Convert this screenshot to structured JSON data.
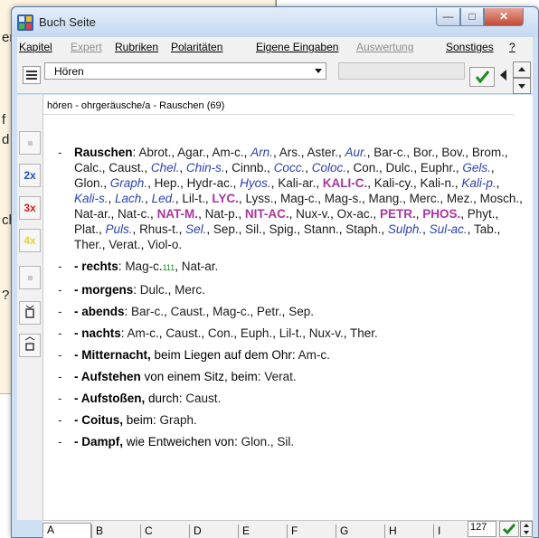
{
  "window": {
    "title": "Buch Seite"
  },
  "background": {
    "fragments": [
      "er",
      "f",
      "d",
      "ch",
      "?"
    ]
  },
  "menu": [
    {
      "label": "Kapitel",
      "enabled": true
    },
    {
      "label": "Expert",
      "enabled": false
    },
    {
      "label": "Rubriken",
      "enabled": true
    },
    {
      "label": "Polaritäten",
      "enabled": true
    },
    {
      "label": "Eigene Eingaben",
      "enabled": true
    },
    {
      "label": "Auswertung",
      "enabled": false
    },
    {
      "label": "Sonstiges",
      "enabled": true
    },
    {
      "label": "?",
      "enabled": true
    }
  ],
  "toolbar": {
    "chapter_value": "Hören"
  },
  "left_tools": {
    "btn_2x": "2x",
    "btn_3x": "3x",
    "btn_4x": "4x",
    "colors": {
      "2x": "#1f4fbf",
      "3x": "#d21f1f",
      "4x": "#e6d23a"
    }
  },
  "path": "hören - ohrgeräusche/a - Rauschen (69)",
  "rubrics": [
    {
      "title": "Rauschen",
      "tail": ":",
      "remedies": [
        {
          "t": "Abrot.",
          "g": 1
        },
        {
          "t": "Agar.",
          "g": 1
        },
        {
          "t": "Am-c.",
          "g": 1
        },
        {
          "t": "Arn.",
          "g": 2
        },
        {
          "t": "Ars.",
          "g": 1
        },
        {
          "t": "Aster.",
          "g": 1
        },
        {
          "t": "Aur.",
          "g": 2
        },
        {
          "t": "Bar-c.",
          "g": 1
        },
        {
          "t": "Bor.",
          "g": 1
        },
        {
          "t": "Bov.",
          "g": 1
        },
        {
          "t": "Brom.",
          "g": 1
        },
        {
          "t": "Calc.",
          "g": 1
        },
        {
          "t": "Caust.",
          "g": 1
        },
        {
          "t": "Chel.",
          "g": 2
        },
        {
          "t": "Chin-s.",
          "g": 2
        },
        {
          "t": "Cinnb.",
          "g": 1
        },
        {
          "t": "Cocc.",
          "g": 2
        },
        {
          "t": "Coloc.",
          "g": 2
        },
        {
          "t": "Con.",
          "g": 1
        },
        {
          "t": "Dulc.",
          "g": 1
        },
        {
          "t": "Euphr.",
          "g": 1
        },
        {
          "t": "Gels.",
          "g": 2
        },
        {
          "t": "Glon.",
          "g": 1
        },
        {
          "t": "Graph.",
          "g": 2
        },
        {
          "t": "Hep.",
          "g": 1
        },
        {
          "t": "Hydr-ac.",
          "g": 1
        },
        {
          "t": "Hyos.",
          "g": 2
        },
        {
          "t": "Kali-ar.",
          "g": 1
        },
        {
          "t": "KALI-C.",
          "g": 3
        },
        {
          "t": "Kali-cy.",
          "g": 1
        },
        {
          "t": "Kali-n.",
          "g": 1
        },
        {
          "t": "Kali-p.",
          "g": 2
        },
        {
          "t": "Kali-s.",
          "g": 2
        },
        {
          "t": "Lach.",
          "g": 2
        },
        {
          "t": "Led.",
          "g": 2
        },
        {
          "t": "Lil-t.",
          "g": 1
        },
        {
          "t": "LYC.",
          "g": 3
        },
        {
          "t": "Lyss.",
          "g": 1
        },
        {
          "t": "Mag-c.",
          "g": 1
        },
        {
          "t": "Mag-s.",
          "g": 1
        },
        {
          "t": "Mang.",
          "g": 1
        },
        {
          "t": "Merc.",
          "g": 1
        },
        {
          "t": "Mez.",
          "g": 1
        },
        {
          "t": "Mosch.",
          "g": 1
        },
        {
          "t": "Nat-ar.",
          "g": 1
        },
        {
          "t": "Nat-c.",
          "g": 1
        },
        {
          "t": "NAT-M.",
          "g": 3
        },
        {
          "t": "Nat-p.",
          "g": 1
        },
        {
          "t": "NIT-AC.",
          "g": 3
        },
        {
          "t": "Nux-v.",
          "g": 1
        },
        {
          "t": "Ox-ac.",
          "g": 1
        },
        {
          "t": "PETR.",
          "g": 3
        },
        {
          "t": "PHOS.",
          "g": 3
        },
        {
          "t": "Phyt.",
          "g": 1
        },
        {
          "t": "Plat.",
          "g": 1
        },
        {
          "t": "Puls.",
          "g": 2
        },
        {
          "t": "Rhus-t.",
          "g": 1
        },
        {
          "t": "Sel.",
          "g": 2
        },
        {
          "t": "Sep.",
          "g": 1
        },
        {
          "t": "Sil.",
          "g": 1
        },
        {
          "t": "Spig.",
          "g": 1
        },
        {
          "t": "Stann.",
          "g": 1
        },
        {
          "t": "Staph.",
          "g": 1
        },
        {
          "t": "Sulph.",
          "g": 2
        },
        {
          "t": "Sul-ac.",
          "g": 2
        },
        {
          "t": "Tab.",
          "g": 1
        },
        {
          "t": "Ther.",
          "g": 1
        },
        {
          "t": "Verat.",
          "g": 1
        },
        {
          "t": "Viol-o.",
          "g": 1
        }
      ]
    },
    {
      "title": "- rechts",
      "tail": ":",
      "remedies": [
        {
          "t": "Mag-c.",
          "g": 1,
          "sup": "111"
        },
        {
          "t": "Nat-ar.",
          "g": 1
        }
      ]
    },
    {
      "title": "- morgens",
      "tail": ":",
      "remedies": [
        {
          "t": "Dulc.",
          "g": 1
        },
        {
          "t": "Merc.",
          "g": 1
        }
      ]
    },
    {
      "title": "- abends",
      "tail": ":",
      "remedies": [
        {
          "t": "Bar-c.",
          "g": 1
        },
        {
          "t": "Caust.",
          "g": 1
        },
        {
          "t": "Mag-c.",
          "g": 1
        },
        {
          "t": "Petr.",
          "g": 1
        },
        {
          "t": "Sep.",
          "g": 1
        }
      ]
    },
    {
      "title": "- nachts",
      "tail": ":",
      "remedies": [
        {
          "t": "Am-c.",
          "g": 1
        },
        {
          "t": "Caust.",
          "g": 1
        },
        {
          "t": "Con.",
          "g": 1
        },
        {
          "t": "Euph.",
          "g": 1
        },
        {
          "t": "Lil-t.",
          "g": 1
        },
        {
          "t": "Nux-v.",
          "g": 1
        },
        {
          "t": "Ther.",
          "g": 1
        }
      ]
    },
    {
      "title": "- Mitternacht,",
      "tail": " beim Liegen auf dem Ohr:",
      "remedies": [
        {
          "t": "Am-c.",
          "g": 1
        }
      ]
    },
    {
      "title": "- Aufstehen",
      "tail": " von einem Sitz, beim:",
      "remedies": [
        {
          "t": "Verat.",
          "g": 1
        }
      ]
    },
    {
      "title": "- Aufstoßen,",
      "tail": " durch:",
      "remedies": [
        {
          "t": "Caust.",
          "g": 1
        }
      ]
    },
    {
      "title": "- Coitus,",
      "tail": " beim:",
      "remedies": [
        {
          "t": "Graph.",
          "g": 1
        }
      ]
    },
    {
      "title": "- Dampf,",
      "tail": " wie Entweichen von:",
      "remedies": [
        {
          "t": "Glon.",
          "g": 1
        },
        {
          "t": "Sil.",
          "g": 1
        }
      ]
    }
  ],
  "letters": [
    "A",
    "B",
    "C",
    "D",
    "E",
    "F",
    "G",
    "H",
    "I"
  ],
  "page_number": "127"
}
